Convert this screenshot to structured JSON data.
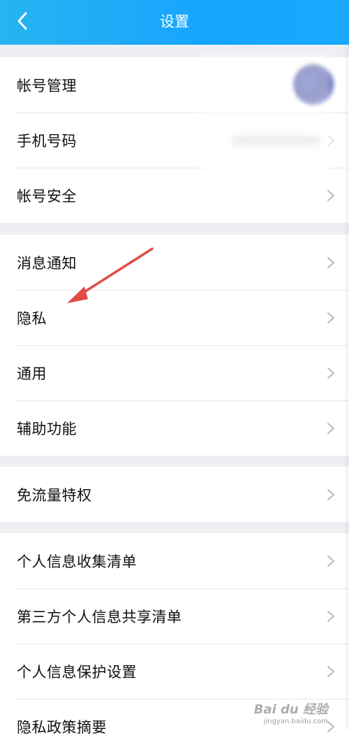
{
  "header": {
    "title": "设置",
    "back_icon": "chevron-left-icon"
  },
  "groups": [
    {
      "items": [
        {
          "label": "帐号管理",
          "trailing": "avatar"
        },
        {
          "label": "手机号码",
          "trailing": "blurred-phone"
        },
        {
          "label": "帐号安全",
          "trailing": "chevron"
        }
      ]
    },
    {
      "items": [
        {
          "label": "消息通知"
        },
        {
          "label": "隐私"
        },
        {
          "label": "通用"
        },
        {
          "label": "辅助功能"
        }
      ]
    },
    {
      "items": [
        {
          "label": "免流量特权"
        }
      ]
    },
    {
      "items": [
        {
          "label": "个人信息收集清单"
        },
        {
          "label": "第三方个人信息共享清单"
        },
        {
          "label": "个人信息保护设置"
        },
        {
          "label": "隐私政策摘要"
        }
      ]
    }
  ],
  "annotation": {
    "type": "arrow",
    "color": "#e04b43",
    "points_to": "隐私"
  },
  "watermark": {
    "main": "Bai du 经验",
    "sub": "jingyan.baidu.com"
  },
  "colors": {
    "header_gradient_start": "#27b4f0",
    "header_gradient_end": "#1aa8ff",
    "background": "#eeeff3",
    "row_text": "#111111",
    "chevron": "#b9b9be"
  }
}
